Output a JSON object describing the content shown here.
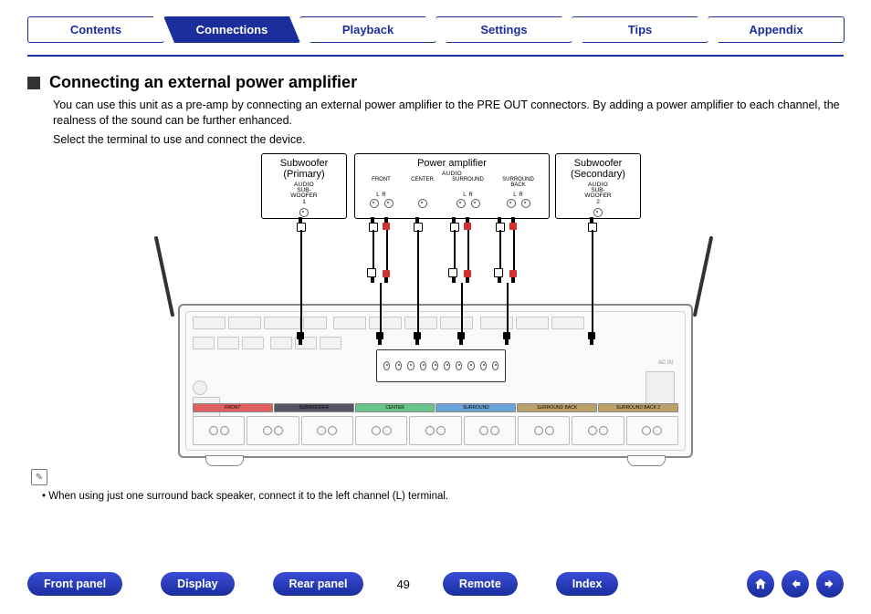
{
  "tabs": {
    "contents": "Contents",
    "connections": "Connections",
    "playback": "Playback",
    "settings": "Settings",
    "tips": "Tips",
    "appendix": "Appendix",
    "active": "connections"
  },
  "heading": "Connecting an external power amplifier",
  "body1": "You can use this unit as a pre-amp by connecting an external power amplifier to the PRE OUT connectors. By adding a power amplifier to each channel, the realness of the sound can be further enhanced.",
  "body2": "Select the terminal to use and connect the device.",
  "diagram": {
    "sub_primary": {
      "title1": "Subwoofer",
      "title2": "(Primary)",
      "audio": "AUDIO",
      "label": "SUB-\nWOOFER",
      "num": "1"
    },
    "power_amp": {
      "title": "Power amplifier",
      "audio": "AUDIO",
      "cols": [
        "FRONT",
        "CENTER",
        "SURROUND",
        "SURROUND\nBACK"
      ],
      "lr": [
        "L",
        "R"
      ]
    },
    "sub_secondary": {
      "title1": "Subwoofer",
      "title2": "(Secondary)",
      "audio": "AUDIO",
      "label": "SUB-\nWOOFER",
      "num": "2"
    },
    "receiver_channels": [
      "FRONT",
      "SUBWOOFER",
      "CENTER",
      "SURROUND",
      "SURROUND BACK",
      "SURROUND BACK 2"
    ],
    "receiver_misc": "AC IN"
  },
  "note_icon": "✎",
  "note": "When using just one surround back speaker, connect it to the left channel (L) terminal.",
  "bottom": {
    "front_panel": "Front panel",
    "display": "Display",
    "rear_panel": "Rear panel",
    "remote": "Remote",
    "index": "Index",
    "page": "49"
  }
}
